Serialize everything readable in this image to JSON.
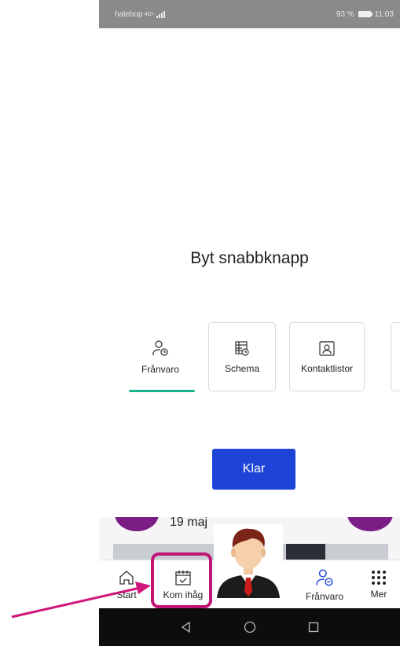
{
  "status_bar": {
    "carrier": "halebop",
    "network": "4G+",
    "battery": "93 %",
    "time": "11:03"
  },
  "sheet": {
    "title": "Byt snabbknapp",
    "quick_buttons": [
      {
        "label": "Frånvaro",
        "icon": "person-clock-icon",
        "selected": true
      },
      {
        "label": "Schema",
        "icon": "calendar-grid-icon",
        "selected": false
      },
      {
        "label": "Kontaktlistor",
        "icon": "contact-card-icon",
        "selected": false
      }
    ],
    "done_label": "Klar"
  },
  "behind": {
    "date": "19 maj"
  },
  "bottom_nav": {
    "items": [
      {
        "label": "Start",
        "icon": "home-icon"
      },
      {
        "label": "Kom ihåg",
        "icon": "calendar-check-icon"
      },
      {
        "label": "Frånvaro",
        "icon": "person-clock-icon"
      },
      {
        "label": "Mer",
        "icon": "dots-grid-icon"
      }
    ]
  },
  "colors": {
    "primary_button": "#1d44d6",
    "selected_underline": "#1db38a",
    "highlight": "#c01577",
    "accent_purple": "#7a1e86"
  }
}
